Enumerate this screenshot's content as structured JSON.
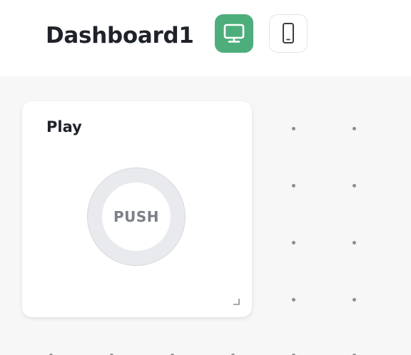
{
  "header": {
    "title": "Dashboard1",
    "view_buttons": [
      {
        "icon": "desktop-monitor-icon",
        "active": true
      },
      {
        "icon": "mobile-phone-icon",
        "active": false
      }
    ]
  },
  "widget": {
    "title": "Play",
    "button_label": "PUSH"
  },
  "colors": {
    "accent": "#4dae7c",
    "text": "#1f2329",
    "canvas_background": "#f7f7f7"
  }
}
